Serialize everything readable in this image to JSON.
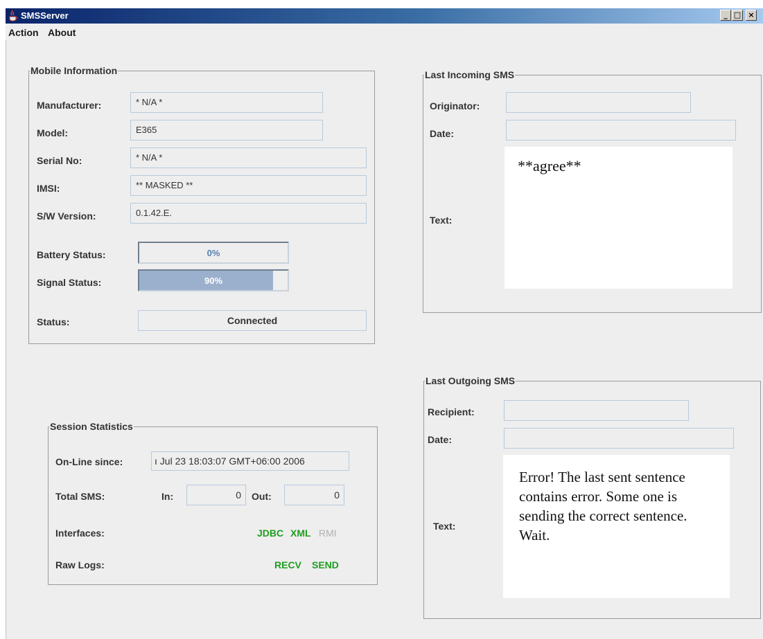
{
  "window": {
    "title": "SMSServer",
    "buttons": [
      "_",
      "□",
      "×"
    ]
  },
  "menu": {
    "items": [
      "Action",
      "About"
    ]
  },
  "mobile_info": {
    "legend": "Mobile Information",
    "manufacturer_label": "Manufacturer:",
    "manufacturer": "* N/A *",
    "model_label": "Model:",
    "model": "E365",
    "serial_label": "Serial No:",
    "serial": "* N/A *",
    "imsi_label": "IMSI:",
    "imsi": "** MASKED **",
    "sw_label": "S/W Version:",
    "sw": "0.1.42.E.",
    "battery_label": "Battery Status:",
    "battery_text": "0%",
    "battery_value": 0,
    "signal_label": "Signal Status:",
    "signal_text": "90%",
    "signal_value": 0.9,
    "status_label": "Status:",
    "status": "Connected"
  },
  "incoming": {
    "legend": "Last Incoming SMS",
    "originator_label": "Originator:",
    "originator": "",
    "date_label": "Date:",
    "date": "",
    "text_label": "Text:",
    "text": "**agree**"
  },
  "outgoing": {
    "legend": "Last Outgoing SMS",
    "recipient_label": "Recipient:",
    "recipient": "",
    "date_label": "Date:",
    "date": "",
    "text_label": "Text:",
    "text": "Error! The last sent sentence contains error. Some one is sending the correct sentence. Wait."
  },
  "session": {
    "legend": "Session Statistics",
    "online_label": "On-Line since:",
    "online": "ı Jul 23 18:03:07 GMT+06:00 2006",
    "total_label": "Total SMS:",
    "in_label": "In:",
    "in": "0",
    "out_label": "Out:",
    "out": "0",
    "interfaces_label": "Interfaces:",
    "interfaces": [
      {
        "name": "JDBC",
        "active": true
      },
      {
        "name": "XML",
        "active": true
      },
      {
        "name": "RMI",
        "active": false
      }
    ],
    "rawlogs_label": "Raw Logs:",
    "rawlogs": [
      {
        "name": "RECV",
        "active": true
      },
      {
        "name": "SEND",
        "active": true
      }
    ]
  },
  "colors": {
    "active": "#1f9e1f",
    "inactive": "#b0b0b0",
    "battery_text": "#5a7fb0",
    "signal_text": "#ffffff"
  }
}
